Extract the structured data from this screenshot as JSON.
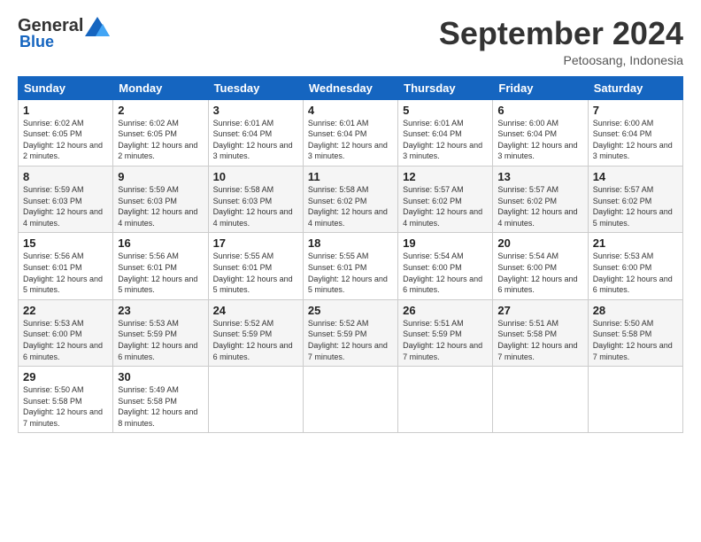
{
  "header": {
    "logo_general": "General",
    "logo_blue": "Blue",
    "month_title": "September 2024",
    "subtitle": "Petoosang, Indonesia"
  },
  "columns": [
    "Sunday",
    "Monday",
    "Tuesday",
    "Wednesday",
    "Thursday",
    "Friday",
    "Saturday"
  ],
  "weeks": [
    [
      {
        "day": "1",
        "sunrise": "6:02 AM",
        "sunset": "6:05 PM",
        "daylight": "12 hours and 2 minutes."
      },
      {
        "day": "2",
        "sunrise": "6:02 AM",
        "sunset": "6:05 PM",
        "daylight": "12 hours and 2 minutes."
      },
      {
        "day": "3",
        "sunrise": "6:01 AM",
        "sunset": "6:04 PM",
        "daylight": "12 hours and 3 minutes."
      },
      {
        "day": "4",
        "sunrise": "6:01 AM",
        "sunset": "6:04 PM",
        "daylight": "12 hours and 3 minutes."
      },
      {
        "day": "5",
        "sunrise": "6:01 AM",
        "sunset": "6:04 PM",
        "daylight": "12 hours and 3 minutes."
      },
      {
        "day": "6",
        "sunrise": "6:00 AM",
        "sunset": "6:04 PM",
        "daylight": "12 hours and 3 minutes."
      },
      {
        "day": "7",
        "sunrise": "6:00 AM",
        "sunset": "6:04 PM",
        "daylight": "12 hours and 3 minutes."
      }
    ],
    [
      {
        "day": "8",
        "sunrise": "5:59 AM",
        "sunset": "6:03 PM",
        "daylight": "12 hours and 4 minutes."
      },
      {
        "day": "9",
        "sunrise": "5:59 AM",
        "sunset": "6:03 PM",
        "daylight": "12 hours and 4 minutes."
      },
      {
        "day": "10",
        "sunrise": "5:58 AM",
        "sunset": "6:03 PM",
        "daylight": "12 hours and 4 minutes."
      },
      {
        "day": "11",
        "sunrise": "5:58 AM",
        "sunset": "6:02 PM",
        "daylight": "12 hours and 4 minutes."
      },
      {
        "day": "12",
        "sunrise": "5:57 AM",
        "sunset": "6:02 PM",
        "daylight": "12 hours and 4 minutes."
      },
      {
        "day": "13",
        "sunrise": "5:57 AM",
        "sunset": "6:02 PM",
        "daylight": "12 hours and 4 minutes."
      },
      {
        "day": "14",
        "sunrise": "5:57 AM",
        "sunset": "6:02 PM",
        "daylight": "12 hours and 5 minutes."
      }
    ],
    [
      {
        "day": "15",
        "sunrise": "5:56 AM",
        "sunset": "6:01 PM",
        "daylight": "12 hours and 5 minutes."
      },
      {
        "day": "16",
        "sunrise": "5:56 AM",
        "sunset": "6:01 PM",
        "daylight": "12 hours and 5 minutes."
      },
      {
        "day": "17",
        "sunrise": "5:55 AM",
        "sunset": "6:01 PM",
        "daylight": "12 hours and 5 minutes."
      },
      {
        "day": "18",
        "sunrise": "5:55 AM",
        "sunset": "6:01 PM",
        "daylight": "12 hours and 5 minutes."
      },
      {
        "day": "19",
        "sunrise": "5:54 AM",
        "sunset": "6:00 PM",
        "daylight": "12 hours and 6 minutes."
      },
      {
        "day": "20",
        "sunrise": "5:54 AM",
        "sunset": "6:00 PM",
        "daylight": "12 hours and 6 minutes."
      },
      {
        "day": "21",
        "sunrise": "5:53 AM",
        "sunset": "6:00 PM",
        "daylight": "12 hours and 6 minutes."
      }
    ],
    [
      {
        "day": "22",
        "sunrise": "5:53 AM",
        "sunset": "6:00 PM",
        "daylight": "12 hours and 6 minutes."
      },
      {
        "day": "23",
        "sunrise": "5:53 AM",
        "sunset": "5:59 PM",
        "daylight": "12 hours and 6 minutes."
      },
      {
        "day": "24",
        "sunrise": "5:52 AM",
        "sunset": "5:59 PM",
        "daylight": "12 hours and 6 minutes."
      },
      {
        "day": "25",
        "sunrise": "5:52 AM",
        "sunset": "5:59 PM",
        "daylight": "12 hours and 7 minutes."
      },
      {
        "day": "26",
        "sunrise": "5:51 AM",
        "sunset": "5:59 PM",
        "daylight": "12 hours and 7 minutes."
      },
      {
        "day": "27",
        "sunrise": "5:51 AM",
        "sunset": "5:58 PM",
        "daylight": "12 hours and 7 minutes."
      },
      {
        "day": "28",
        "sunrise": "5:50 AM",
        "sunset": "5:58 PM",
        "daylight": "12 hours and 7 minutes."
      }
    ],
    [
      {
        "day": "29",
        "sunrise": "5:50 AM",
        "sunset": "5:58 PM",
        "daylight": "12 hours and 7 minutes."
      },
      {
        "day": "30",
        "sunrise": "5:49 AM",
        "sunset": "5:58 PM",
        "daylight": "12 hours and 8 minutes."
      },
      null,
      null,
      null,
      null,
      null
    ]
  ],
  "labels": {
    "sunrise": "Sunrise:",
    "sunset": "Sunset:",
    "daylight": "Daylight:"
  }
}
